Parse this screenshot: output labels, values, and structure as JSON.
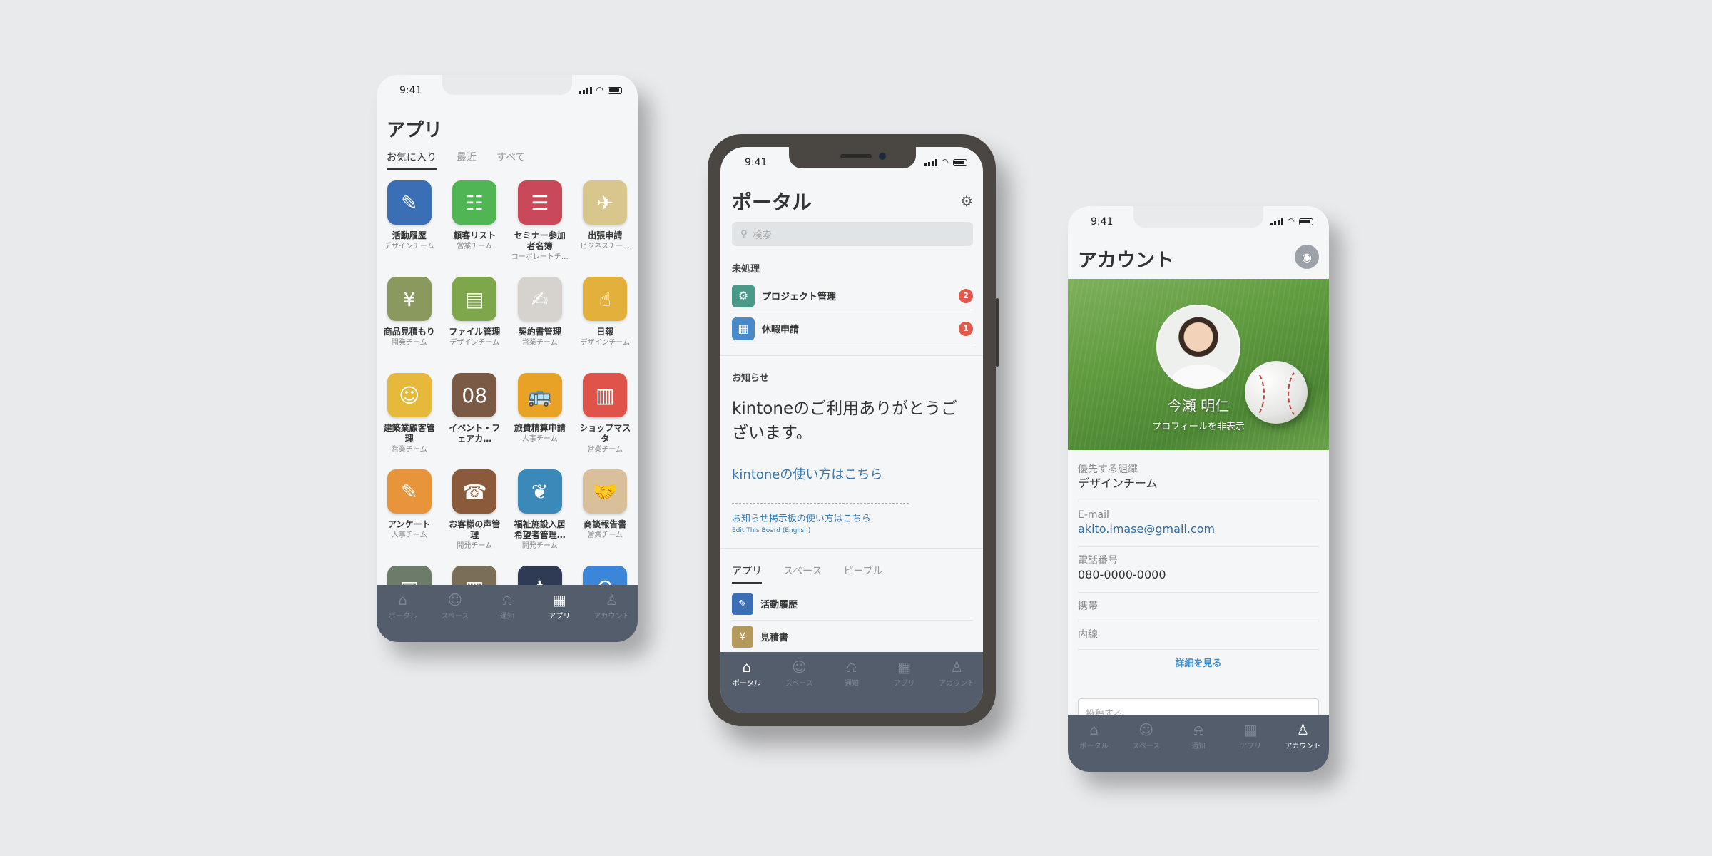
{
  "status_time": "9:41",
  "tabbar": [
    {
      "label": "ポータル",
      "icon": "home-icon",
      "glyph": "⌂"
    },
    {
      "label": "スペース",
      "icon": "chat-icon",
      "glyph": "☺"
    },
    {
      "label": "通知",
      "icon": "bell-icon",
      "glyph": "⍾"
    },
    {
      "label": "アプリ",
      "icon": "grid-icon",
      "glyph": "▦"
    },
    {
      "label": "アカウント",
      "icon": "user-icon",
      "glyph": "♙"
    }
  ],
  "apps_screen": {
    "title": "アプリ",
    "tabs": [
      "お気に入り",
      "最近",
      "すべて"
    ],
    "apps": [
      {
        "name": "活動履歴",
        "team": "デザインチーム",
        "color": "#3a6fb5",
        "glyph": "✎"
      },
      {
        "name": "顧客リスト",
        "team": "営業チーム",
        "color": "#4fb653",
        "glyph": "☷"
      },
      {
        "name": "セミナー参加者名簿",
        "team": "コーポレートチ…",
        "color": "#c9495a",
        "glyph": "☰"
      },
      {
        "name": "出張申請",
        "team": "ビジネスチー…",
        "color": "#d8c68d",
        "glyph": "✈"
      },
      {
        "name": "商品見積もり",
        "team": "開発チーム",
        "color": "#8a9a5f",
        "glyph": "¥"
      },
      {
        "name": "ファイル管理",
        "team": "デザインチーム",
        "color": "#7ea64b",
        "glyph": "▤"
      },
      {
        "name": "契約書管理",
        "team": "営業チーム",
        "color": "#d6d3cf",
        "glyph": "✍"
      },
      {
        "name": "日報",
        "team": "デザインチーム",
        "color": "#e3b13b",
        "glyph": "☝"
      },
      {
        "name": "建築業顧客管理",
        "team": "営業チーム",
        "color": "#e7b93a",
        "glyph": "☺"
      },
      {
        "name": "イベント・フェアカ…",
        "team": "",
        "color": "#7b5a45",
        "glyph": "08"
      },
      {
        "name": "旅費精算申請",
        "team": "人事チーム",
        "color": "#e8a226",
        "glyph": "🚌"
      },
      {
        "name": "ショップマスタ",
        "team": "営業チーム",
        "color": "#e0534a",
        "glyph": "▥"
      },
      {
        "name": "アンケート",
        "team": "人事チーム",
        "color": "#e8943a",
        "glyph": "✎"
      },
      {
        "name": "お客様の声管理",
        "team": "開発チーム",
        "color": "#8a5a3b",
        "glyph": "☎"
      },
      {
        "name": "福祉施設入居希望者管理…",
        "team": "開発チーム",
        "color": "#3a89b8",
        "glyph": "❦"
      },
      {
        "name": "商談報告書",
        "team": "営業チーム",
        "color": "#d9c09a",
        "glyph": "🤝"
      },
      {
        "name": "",
        "team": "",
        "color": "#6c7b6a",
        "glyph": "▣"
      },
      {
        "name": "",
        "team": "",
        "color": "#7a6e58",
        "glyph": "▦"
      },
      {
        "name": "",
        "team": "",
        "color": "#2f3a55",
        "glyph": "♟"
      },
      {
        "name": "",
        "team": "",
        "color": "#3b86d9",
        "glyph": "Q"
      }
    ]
  },
  "portal_screen": {
    "title": "ポータル",
    "search_placeholder": "検索",
    "pending_label": "未処理",
    "pending": [
      {
        "label": "プロジェクト管理",
        "count": "2",
        "color": "#4a9a8a",
        "glyph": "⚙"
      },
      {
        "label": "休暇申請",
        "count": "1",
        "color": "#4a8ac9",
        "glyph": "▦"
      }
    ],
    "notice_label": "お知らせ",
    "notice_body": "kintoneのご利用ありがとうございます。",
    "link_howto": "kintoneの使い方はこちら",
    "link_board": "お知らせ掲示板の使い方はこちら",
    "link_edit": "Edit This Board (English)",
    "tabs": [
      "アプリ",
      "スペース",
      "ピープル"
    ],
    "apps": [
      {
        "label": "活動履歴",
        "color": "#3a6fb5",
        "glyph": "✎"
      },
      {
        "label": "見積書",
        "color": "#b49a5a",
        "glyph": "¥"
      }
    ]
  },
  "account_screen": {
    "title": "アカウント",
    "user_name": "今瀬 明仁",
    "hide_profile": "プロフィールを非表示",
    "fields": [
      {
        "label": "優先する組織",
        "value": "デザインチーム",
        "link": false
      },
      {
        "label": "E-mail",
        "value": "akito.imase@gmail.com",
        "link": true
      },
      {
        "label": "電話番号",
        "value": "080-0000-0000",
        "link": false
      },
      {
        "label": "携帯",
        "value": "",
        "link": false
      },
      {
        "label": "内線",
        "value": "",
        "link": false
      }
    ],
    "more_label": "詳細を見る",
    "post_placeholder": "投稿する"
  },
  "active_tabs": {
    "apps": 3,
    "portal": 0,
    "account": 4
  }
}
